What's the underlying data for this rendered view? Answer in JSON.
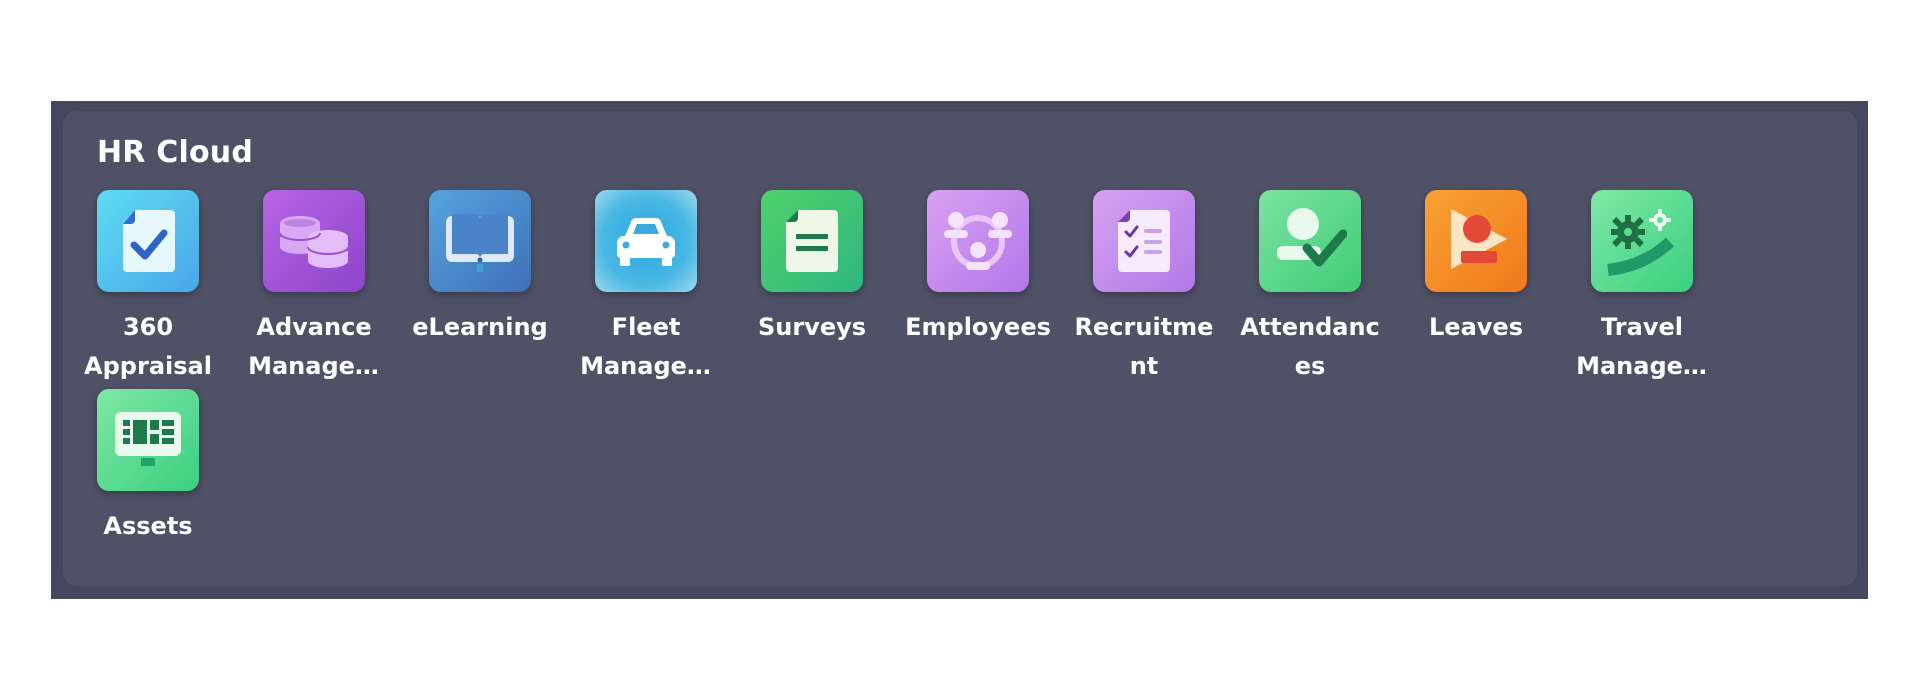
{
  "panel": {
    "title": "HR Cloud"
  },
  "apps": [
    {
      "label": "360 Appraisal",
      "icon": "appraisal-doc-check-icon",
      "color": "#4fc6ee"
    },
    {
      "label": "Advance Managem…",
      "icon": "coins-stack-icon",
      "color": "#a256d8"
    },
    {
      "label": "eLearning",
      "icon": "open-book-icon",
      "color": "#4b89cc"
    },
    {
      "label": "Fleet Managem…",
      "icon": "car-icon",
      "color": "#41b0e0"
    },
    {
      "label": "Surveys",
      "icon": "survey-document-icon",
      "color": "#3cc575"
    },
    {
      "label": "Employees",
      "icon": "employees-group-icon",
      "color": "#c68cee"
    },
    {
      "label": "Recruitment",
      "icon": "checklist-icon",
      "color": "#c48cee"
    },
    {
      "label": "Attendances",
      "icon": "user-check-icon",
      "color": "#5dd88b"
    },
    {
      "label": "Leaves",
      "icon": "user-flag-icon",
      "color": "#f48d28"
    },
    {
      "label": "Travel Managem…",
      "icon": "gears-road-icon",
      "color": "#5cdc93"
    },
    {
      "label": "Assets",
      "icon": "monitor-dashboard-icon",
      "color": "#5cdc93"
    }
  ]
}
